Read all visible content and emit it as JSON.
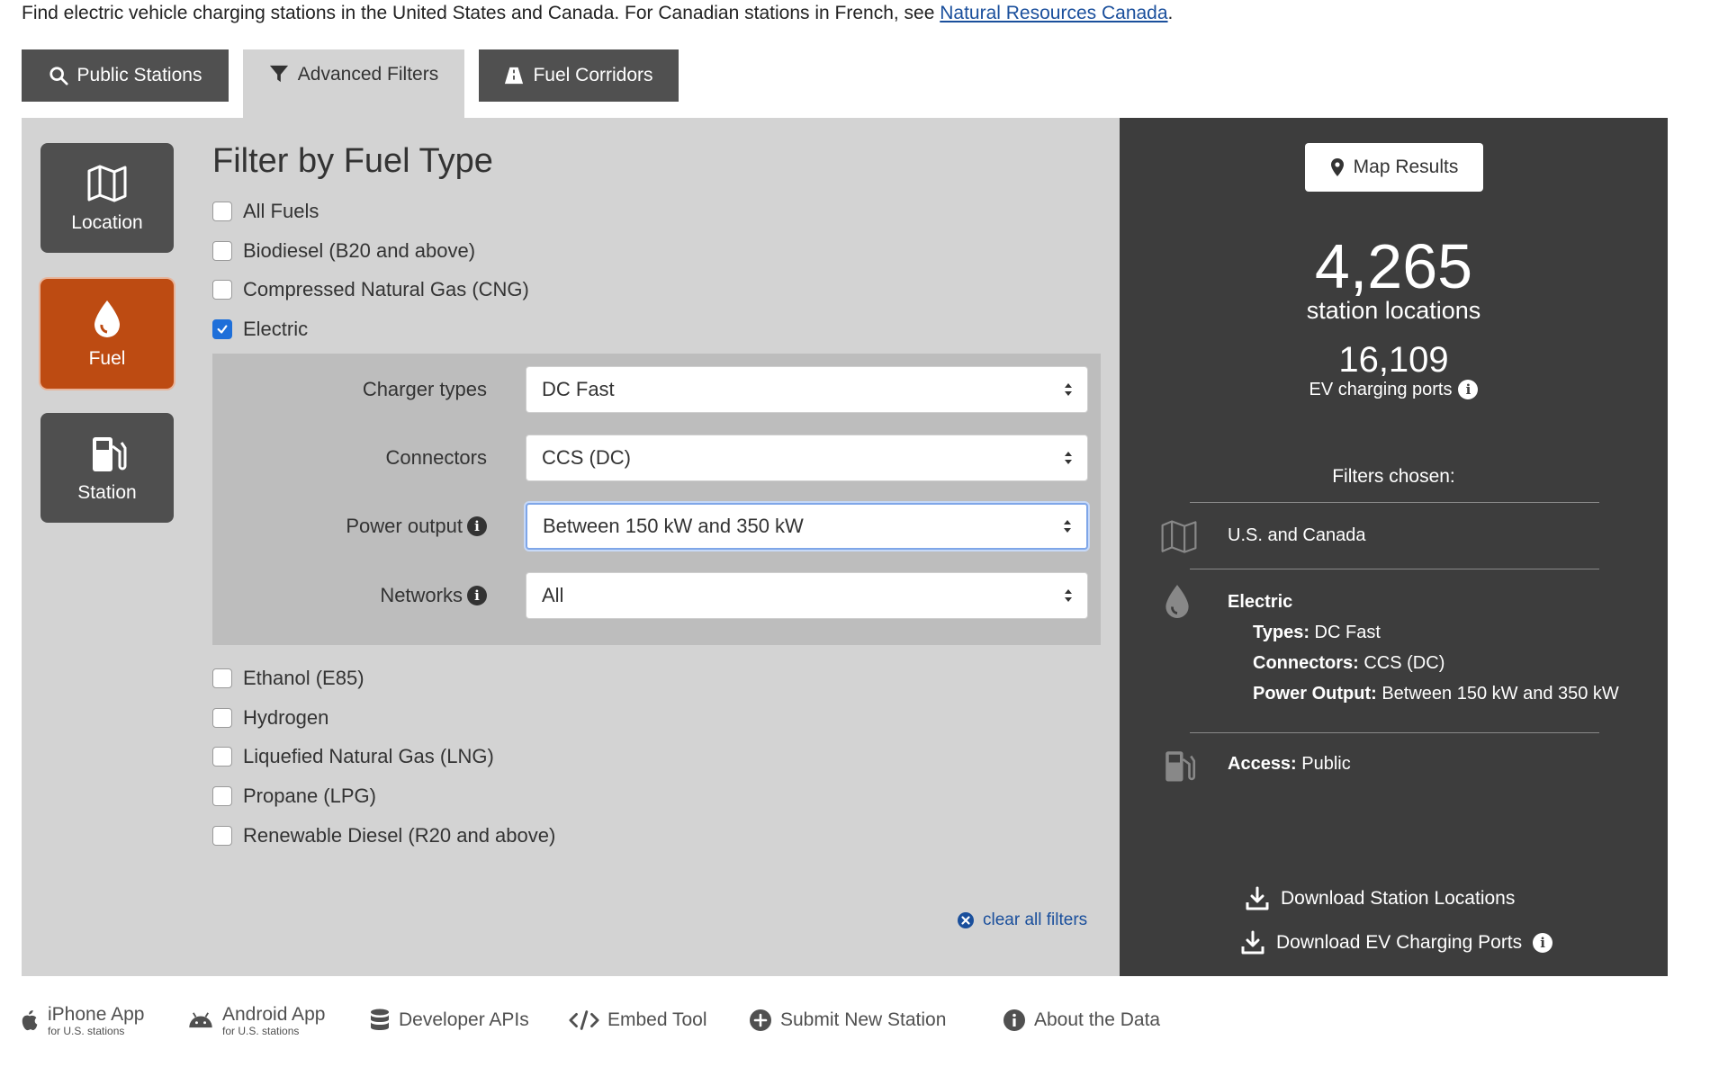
{
  "intro": {
    "text": "Find electric vehicle charging stations in the United States and Canada. For Canadian stations in French, see ",
    "link": "Natural Resources Canada",
    "trailing": "."
  },
  "tabs": [
    {
      "label": "Public Stations",
      "icon": "search-icon",
      "active": false
    },
    {
      "label": "Advanced Filters",
      "icon": "filter-icon",
      "active": true
    },
    {
      "label": "Fuel Corridors",
      "icon": "road-icon",
      "active": false
    }
  ],
  "categories": [
    {
      "label": "Location",
      "icon": "map-icon",
      "active": false
    },
    {
      "label": "Fuel",
      "icon": "fuel-drop-icon",
      "active": true
    },
    {
      "label": "Station",
      "icon": "fuel-pump-icon",
      "active": false
    }
  ],
  "filter": {
    "heading": "Filter by Fuel Type",
    "fuels_top": [
      {
        "label": "All Fuels",
        "checked": false
      },
      {
        "label": "Biodiesel (B20 and above)",
        "checked": false
      },
      {
        "label": "Compressed Natural Gas (CNG)",
        "checked": false
      },
      {
        "label": "Electric",
        "checked": true
      }
    ],
    "electric_options": [
      {
        "label": "Charger types",
        "value": "DC Fast",
        "info": false
      },
      {
        "label": "Connectors",
        "value": "CCS (DC)",
        "info": false
      },
      {
        "label": "Power output",
        "value": "Between 150 kW and 350 kW",
        "info": true
      },
      {
        "label": "Networks",
        "value": "All",
        "info": true
      }
    ],
    "fuels_bottom": [
      {
        "label": "Ethanol (E85)",
        "checked": false
      },
      {
        "label": "Hydrogen",
        "checked": false
      },
      {
        "label": "Liquefied Natural Gas (LNG)",
        "checked": false
      },
      {
        "label": "Propane (LPG)",
        "checked": false
      },
      {
        "label": "Renewable Diesel (R20 and above)",
        "checked": false
      }
    ],
    "clear_all": "clear all filters"
  },
  "results": {
    "map_button": "Map Results",
    "station_count": "4,265",
    "station_label": "station locations",
    "port_count": "16,109",
    "port_label": "EV charging ports",
    "filters_heading": "Filters chosen:",
    "location": "U.S. and Canada",
    "fuel": {
      "name": "Electric",
      "types_label": "Types:",
      "types_value": "DC Fast",
      "connectors_label": "Connectors:",
      "connectors_value": "CCS (DC)",
      "power_label": "Power Output:",
      "power_value": "Between 150 kW and 350 kW"
    },
    "access_label": "Access:",
    "access_value": "Public",
    "download_locations": "Download Station Locations",
    "download_ports": "Download EV Charging Ports"
  },
  "footer": [
    {
      "label": "iPhone App",
      "sub": "for U.S. stations",
      "icon": "apple-icon"
    },
    {
      "label": "Android App",
      "sub": "for U.S. stations",
      "icon": "android-icon"
    },
    {
      "label": "Developer APIs",
      "icon": "database-icon"
    },
    {
      "label": "Embed Tool",
      "icon": "code-icon"
    },
    {
      "label": "Submit New Station",
      "icon": "plus-circle-icon"
    },
    {
      "label": "About the Data",
      "icon": "info-circle-icon"
    }
  ],
  "colors": {
    "accent_orange": "#bd4b12",
    "dark_tab": "#505050",
    "dark_panel": "#3d3d3d",
    "light_panel": "#d3d3d3",
    "sub_panel": "#bdbdbd",
    "link_blue": "#1a4f9c",
    "checkbox_blue": "#1e6fd9"
  }
}
